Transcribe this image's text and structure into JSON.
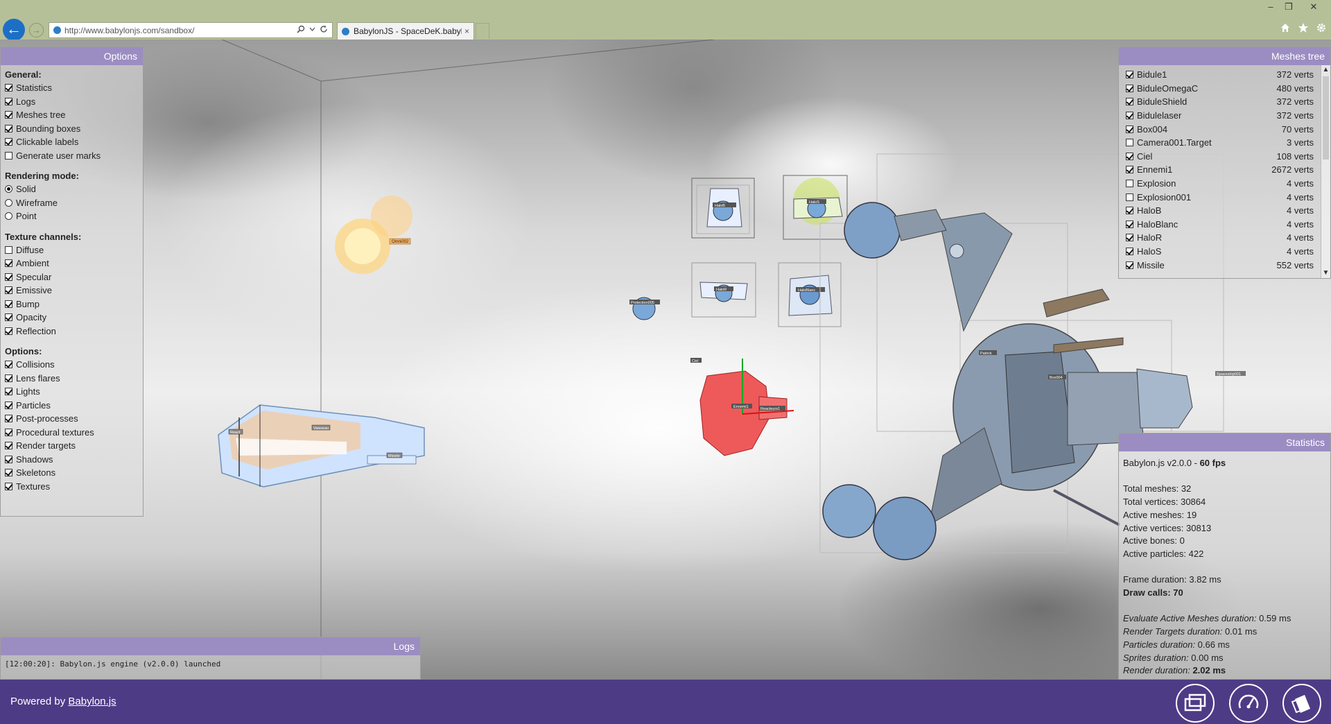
{
  "browser": {
    "url": "http://www.babylonjs.com/sandbox/",
    "tab_title": "BabylonJS - SpaceDeK.babyl...",
    "tab_close": "×",
    "back_glyph": "←",
    "forward_glyph": "→",
    "window_controls": {
      "minimize": "–",
      "restore": "❐",
      "close": "✕"
    },
    "icons": {
      "search": "search-icon",
      "dropdown": "chevron-down-icon",
      "refresh": "refresh-icon",
      "home": "home-icon",
      "favorites": "star-icon",
      "settings": "gear-icon"
    }
  },
  "options_panel": {
    "title": "Options",
    "general": {
      "heading": "General:",
      "items": [
        {
          "label": "Statistics",
          "checked": true
        },
        {
          "label": "Logs",
          "checked": true
        },
        {
          "label": "Meshes tree",
          "checked": true
        },
        {
          "label": "Bounding boxes",
          "checked": true
        },
        {
          "label": "Clickable labels",
          "checked": true
        },
        {
          "label": "Generate user marks",
          "checked": false
        }
      ]
    },
    "rendering": {
      "heading": "Rendering mode:",
      "items": [
        {
          "label": "Solid",
          "selected": true
        },
        {
          "label": "Wireframe",
          "selected": false
        },
        {
          "label": "Point",
          "selected": false
        }
      ]
    },
    "texture_channels": {
      "heading": "Texture channels:",
      "items": [
        {
          "label": "Diffuse",
          "checked": false
        },
        {
          "label": "Ambient",
          "checked": true
        },
        {
          "label": "Specular",
          "checked": true
        },
        {
          "label": "Emissive",
          "checked": true
        },
        {
          "label": "Bump",
          "checked": true
        },
        {
          "label": "Opacity",
          "checked": true
        },
        {
          "label": "Reflection",
          "checked": true
        }
      ]
    },
    "options": {
      "heading": "Options:",
      "items": [
        {
          "label": "Collisions",
          "checked": true
        },
        {
          "label": "Lens flares",
          "checked": true
        },
        {
          "label": "Lights",
          "checked": true
        },
        {
          "label": "Particles",
          "checked": true
        },
        {
          "label": "Post-processes",
          "checked": true
        },
        {
          "label": "Procedural textures",
          "checked": true
        },
        {
          "label": "Render targets",
          "checked": true
        },
        {
          "label": "Shadows",
          "checked": true
        },
        {
          "label": "Skeletons",
          "checked": true
        },
        {
          "label": "Textures",
          "checked": true
        }
      ]
    }
  },
  "meshes_panel": {
    "title": "Meshes tree",
    "items": [
      {
        "name": "Bidule1",
        "verts": "372 verts",
        "checked": true
      },
      {
        "name": "BiduleOmegaC",
        "verts": "480 verts",
        "checked": true
      },
      {
        "name": "BiduleShield",
        "verts": "372 verts",
        "checked": true
      },
      {
        "name": "Bidulelaser",
        "verts": "372 verts",
        "checked": true
      },
      {
        "name": "Box004",
        "verts": "70 verts",
        "checked": true
      },
      {
        "name": "Camera001.Target",
        "verts": "3 verts",
        "checked": false
      },
      {
        "name": "Ciel",
        "verts": "108 verts",
        "checked": true
      },
      {
        "name": "Ennemi1",
        "verts": "2672 verts",
        "checked": true
      },
      {
        "name": "Explosion",
        "verts": "4 verts",
        "checked": false
      },
      {
        "name": "Explosion001",
        "verts": "4 verts",
        "checked": false
      },
      {
        "name": "HaloB",
        "verts": "4 verts",
        "checked": true
      },
      {
        "name": "HaloBlanc",
        "verts": "4 verts",
        "checked": true
      },
      {
        "name": "HaloR",
        "verts": "4 verts",
        "checked": true
      },
      {
        "name": "HaloS",
        "verts": "4 verts",
        "checked": true
      },
      {
        "name": "Missile",
        "verts": "552 verts",
        "checked": true
      }
    ]
  },
  "stats_panel": {
    "title": "Statistics",
    "engine": "Babylon.js v2.0.0 - ",
    "fps": "60 fps",
    "counts": [
      "Total meshes: 32",
      "Total vertices: 30864",
      "Active meshes: 19",
      "Active vertices: 30813",
      "Active bones: 0",
      "Active particles: 422"
    ],
    "frame_duration": "Frame duration: 3.82 ms",
    "draw_calls": "Draw calls: 70",
    "durations": [
      {
        "label": "Evaluate Active Meshes duration:",
        "value": " 0.59 ms"
      },
      {
        "label": "Render Targets duration:",
        "value": " 0.01 ms"
      },
      {
        "label": "Particles duration:",
        "value": " 0.66 ms"
      },
      {
        "label": "Sprites duration:",
        "value": " 0.00 ms"
      }
    ],
    "render_label": "Render duration: ",
    "render_value": "2.02 ms"
  },
  "logs_panel": {
    "title": "Logs",
    "entries": [
      "[12:00:20]: Babylon.js engine (v2.0.0) launched"
    ]
  },
  "footer": {
    "powered_prefix": "Powered by ",
    "powered_link": "Babylon.js",
    "buttons": [
      "fullscreen-icon",
      "performance-gauge-icon",
      "open-file-icon"
    ]
  },
  "scene_labels": {
    "omni": "Omni002",
    "ciel": "Ciel",
    "enemy": "Ennemi1",
    "reactor": "Reacteurs1",
    "patrick": "Patrick",
    "box": "Box004",
    "spaceship": "Spaceship001",
    "halo_b": "HaloB",
    "halo_r": "HaloR",
    "halo_blanc": "HaloBlanc",
    "halo_s": "HaloS",
    "protection": "Protection005",
    "fighter_left": "React",
    "fighter_mid": "Vaisseau",
    "missile": "Missile"
  }
}
